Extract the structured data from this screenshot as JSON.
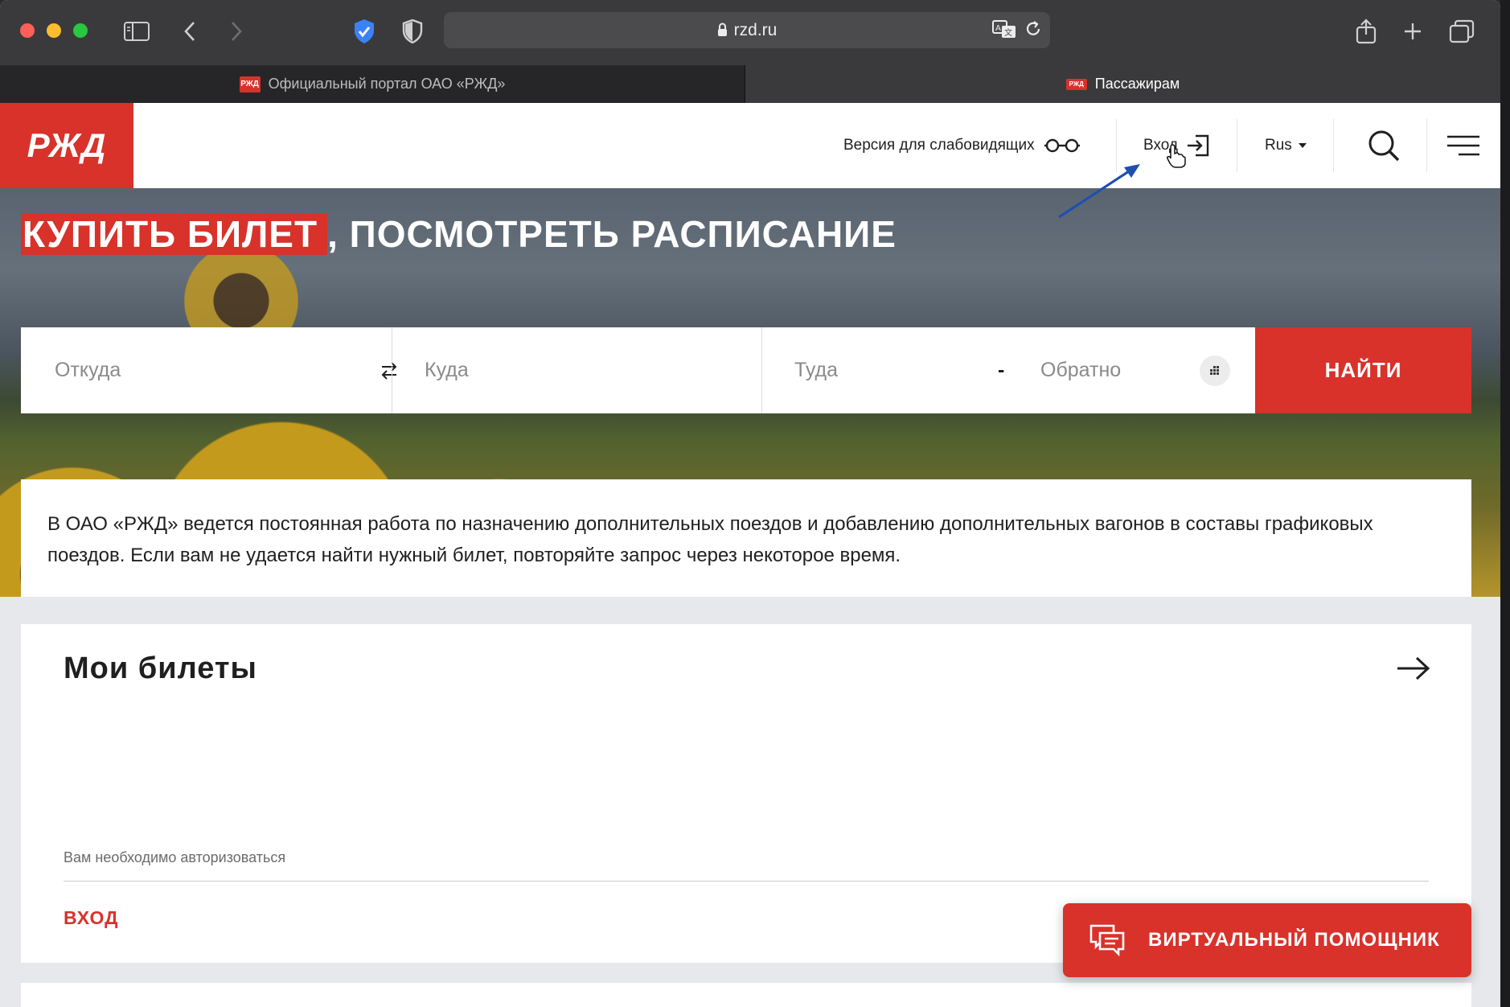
{
  "browser": {
    "url_domain": "rzd.ru",
    "tabs": [
      {
        "label": "Официальный портал ОАО «РЖД»",
        "favicon": "РЖД"
      },
      {
        "label": "Пассажирам",
        "favicon": "РЖД"
      }
    ]
  },
  "header": {
    "logo_text": "РЖД",
    "accessibility_label": "Версия для слабовидящих",
    "login_label": "Вход",
    "language_label": "Rus"
  },
  "hero": {
    "title_highlight": "КУПИТЬ БИЛЕТ",
    "title_rest": ", ПОСМОТРЕТЬ РАСПИСАНИЕ"
  },
  "search": {
    "from_placeholder": "Откуда",
    "to_placeholder": "Куда",
    "depart_placeholder": "Туда",
    "dash": "-",
    "return_placeholder": "Обратно",
    "submit_label": "НАЙТИ"
  },
  "notice": {
    "text": "В ОАО «РЖД» ведется постоянная работа по назначению дополнительных поездов и добавлению дополнительных вагонов в составы графиковых поездов. Если вам не удается найти нужный билет, повторяйте запрос через некоторое время."
  },
  "tickets": {
    "title": "Мои билеты",
    "auth_hint": "Вам необходимо авторизоваться",
    "login_link": "ВХОД"
  },
  "assistant": {
    "label": "ВИРТУАЛЬНЫЙ ПОМОЩНИК"
  },
  "colors": {
    "brand_red": "#d8322b",
    "annotation_arrow": "#1f4fb0"
  },
  "icons": [
    "sidebar-icon",
    "back-icon",
    "forward-icon",
    "shield-check-icon",
    "privacy-shield-icon",
    "lock-icon",
    "translate-icon",
    "reload-icon",
    "share-icon",
    "new-tab-icon",
    "tab-overview-icon",
    "glasses-icon",
    "login-icon",
    "dropdown-caret-icon",
    "search-icon",
    "menu-icon",
    "swap-icon",
    "calendar-icon",
    "arrow-right-icon",
    "chat-icon",
    "pointer-cursor-icon"
  ]
}
